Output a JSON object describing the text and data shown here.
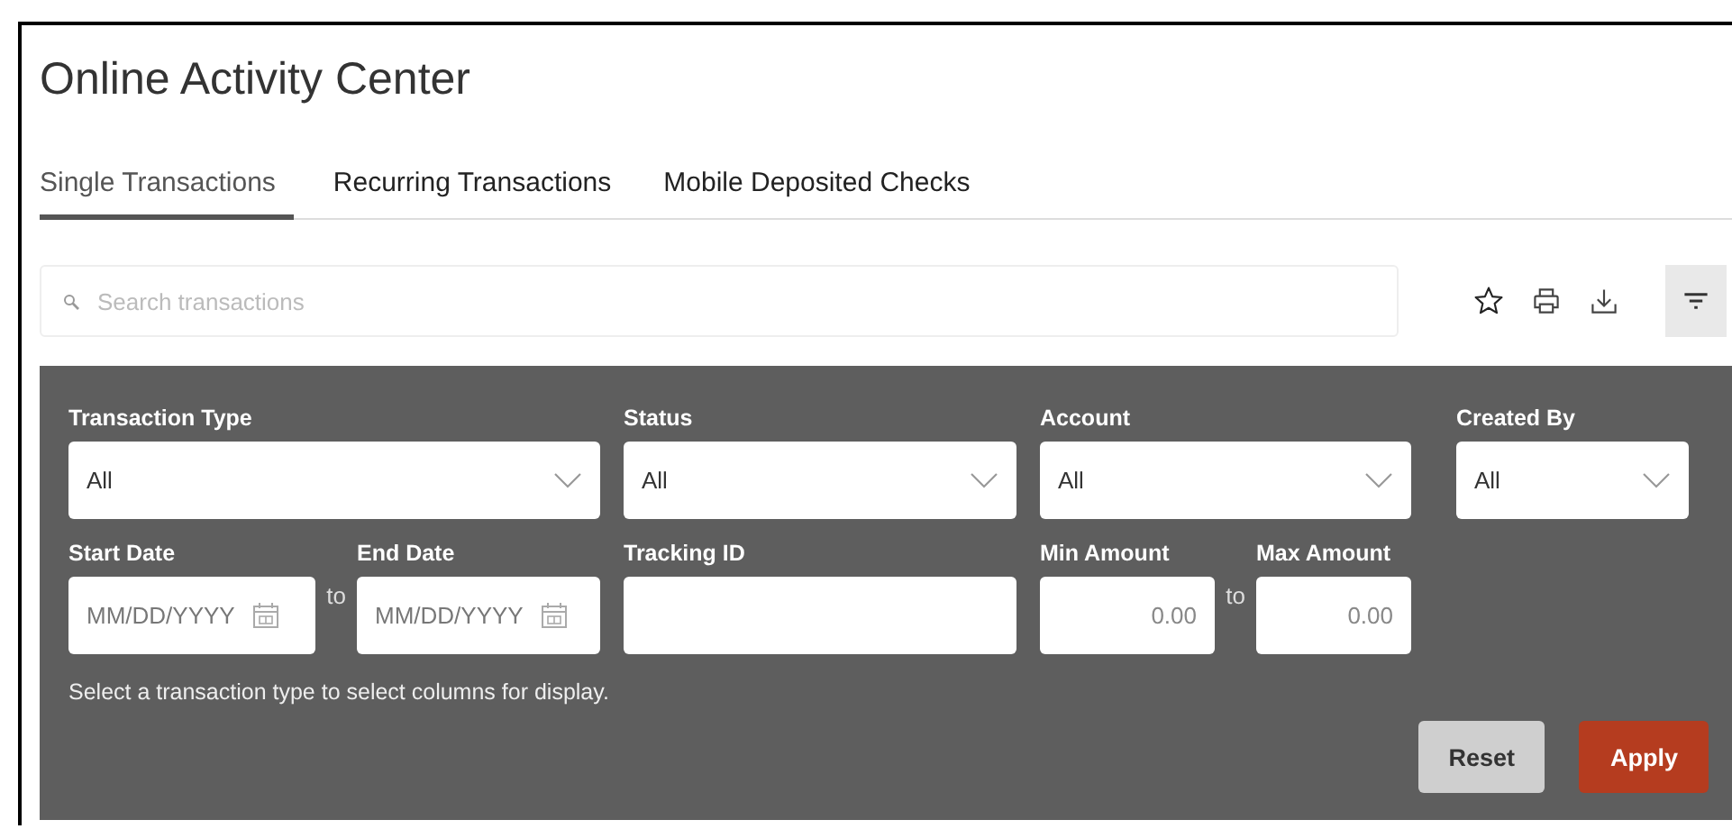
{
  "title": "Online Activity Center",
  "tabs": [
    {
      "label": "Single Transactions",
      "selected": true
    },
    {
      "label": "Recurring Transactions",
      "selected": false
    },
    {
      "label": "Mobile Deposited Checks",
      "selected": false
    }
  ],
  "search": {
    "placeholder": "Search transactions"
  },
  "toolbar": [
    {
      "kind": "star",
      "selected": false
    },
    {
      "kind": "print",
      "selected": false
    },
    {
      "kind": "download",
      "selected": false
    },
    {
      "kind": "filter",
      "selected": true
    }
  ],
  "filters": [
    {
      "kind": "select",
      "label": "Transaction Type",
      "value": "All"
    },
    {
      "kind": "select",
      "label": "Status",
      "value": "All"
    },
    {
      "kind": "select",
      "label": "Account",
      "value": "All"
    },
    {
      "kind": "select",
      "label": "Created By",
      "value": "All"
    },
    {
      "kind": "date_range",
      "separator": "to",
      "fields": [
        {
          "label": "Start Date",
          "placeholder": "MM/DD/YYYY"
        },
        {
          "label": "End Date",
          "placeholder": "MM/DD/YYYY"
        }
      ]
    },
    {
      "kind": "text",
      "label": "Tracking ID"
    },
    {
      "kind": "amount_range",
      "separator": "to",
      "fields": [
        {
          "label": "Min Amount",
          "placeholder": "0.00"
        },
        {
          "label": "Max Amount",
          "placeholder": "0.00"
        }
      ]
    }
  ],
  "hint": "Select a transaction type to select columns for display.",
  "buttons": [
    {
      "kind": "secondary",
      "label": "Reset"
    },
    {
      "kind": "primary",
      "label": "Apply"
    }
  ]
}
